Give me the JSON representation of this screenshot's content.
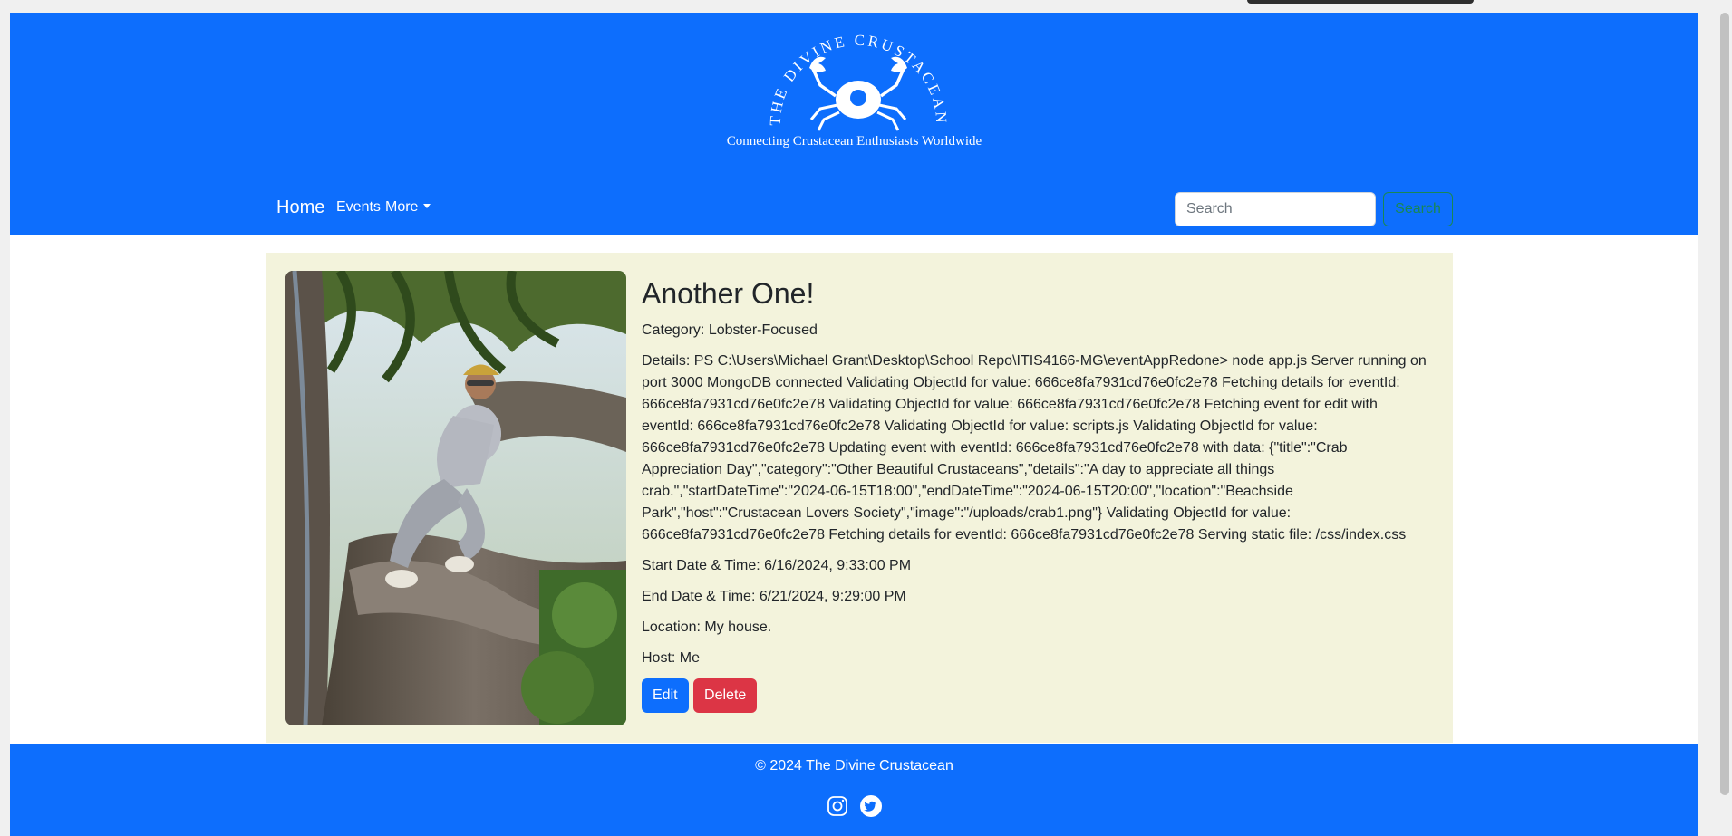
{
  "header": {
    "logo_text": "THE DIVINE CRUSTACEAN",
    "tagline": "Connecting Crustacean Enthusiasts Worldwide"
  },
  "nav": {
    "home": "Home",
    "events": "Events",
    "more": "More"
  },
  "search": {
    "placeholder": "Search",
    "value": "",
    "button": "Search"
  },
  "event": {
    "title": "Another One!",
    "category": "Category: Lobster-Focused",
    "details": "Details: PS C:\\Users\\Michael Grant\\Desktop\\School Repo\\ITIS4166-MG\\eventAppRedone> node app.js Server running on port 3000 MongoDB connected Validating ObjectId for value: 666ce8fa7931cd76e0fc2e78 Fetching details for eventId: 666ce8fa7931cd76e0fc2e78 Validating ObjectId for value: 666ce8fa7931cd76e0fc2e78 Fetching event for edit with eventId: 666ce8fa7931cd76e0fc2e78 Validating ObjectId for value: scripts.js Validating ObjectId for value: 666ce8fa7931cd76e0fc2e78 Updating event with eventId: 666ce8fa7931cd76e0fc2e78 with data: {\"title\":\"Crab Appreciation Day\",\"category\":\"Other Beautiful Crustaceans\",\"details\":\"A day to appreciate all things crab.\",\"startDateTime\":\"2024-06-15T18:00\",\"endDateTime\":\"2024-06-15T20:00\",\"location\":\"Beachside Park\",\"host\":\"Crustacean Lovers Society\",\"image\":\"/uploads/crab1.png\"} Validating ObjectId for value: 666ce8fa7931cd76e0fc2e78 Fetching details for eventId: 666ce8fa7931cd76e0fc2e78 Serving static file: /css/index.css",
    "start": "Start Date & Time: 6/16/2024, 9:33:00 PM",
    "end": "End Date & Time: 6/21/2024, 9:29:00 PM",
    "location": "Location: My house.",
    "host": "Host: Me",
    "edit_label": "Edit",
    "delete_label": "Delete"
  },
  "footer": {
    "copyright": "© 2024 The Divine Crustacean",
    "icons": [
      "instagram-icon",
      "twitter-icon"
    ]
  },
  "colors": {
    "brand_blue": "#0d6efd",
    "card_bg": "#f3f3dc",
    "delete_red": "#dc3545",
    "search_outline": "#198754"
  }
}
